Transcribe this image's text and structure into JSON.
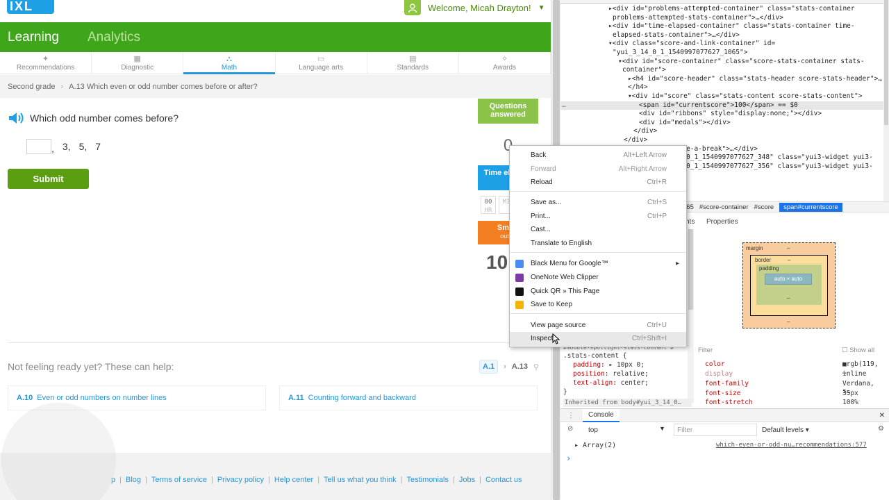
{
  "ixl": {
    "logo": "IXL",
    "welcome": "Welcome, Micah Drayton!",
    "nav": {
      "learning": "Learning",
      "analytics": "Analytics"
    },
    "subnav": [
      "Recommendations",
      "Diagnostic",
      "Math",
      "Language arts",
      "Standards",
      "Awards"
    ],
    "breadcrumb": {
      "grade": "Second grade",
      "sep": "›",
      "skill": "A.13 Which even or odd number comes before or after?"
    },
    "question": "Which odd number comes before?",
    "sequence": [
      ",",
      "3,",
      "5,",
      "7"
    ],
    "submit": "Submit",
    "stats": {
      "questions_answered_label": "Questions answered",
      "questions_answered_value": "0",
      "time_elapsed_label": "Time elapsed",
      "time_cells": [
        {
          "num": "00",
          "unit": "HR"
        },
        {
          "num": "",
          "unit": "MI"
        }
      ],
      "smartscore_label": "Smart",
      "smartscore_sub": "out of",
      "smartscore_value": "10"
    },
    "help": {
      "title": "Not feeling ready yet? These can help:",
      "path_from": "A.1",
      "path_arrow": "›",
      "path_to": "A.13",
      "cards": [
        {
          "code": "A.10",
          "label": "Even or odd numbers on number lines"
        },
        {
          "code": "A.11",
          "label": "Counting forward and backward"
        }
      ]
    },
    "footer_links": [
      "p",
      "Blog",
      "Terms of service",
      "Privacy policy",
      "Help center",
      "Tell us what you think",
      "Testimonials",
      "Jobs",
      "Contact us"
    ],
    "footer_sep": "|"
  },
  "devtools": {
    "elements": [
      {
        "text": "▸<div id=\"problems-attempted-container\" class=\"stats-container",
        "indent": 876
      },
      {
        "text": "problems-attempted-stats-container\">…</div>",
        "indent": 882
      },
      {
        "text": "▸<div id=\"time-elapsed-container\" class=\"stats-container time-",
        "indent": 876
      },
      {
        "text": "elapsed-stats-container\">…</div>",
        "indent": 882
      },
      {
        "text": "▾<div class=\"score-and-link-container\" id=",
        "indent": 876
      },
      {
        "text": "\"yui_3_14_0_1_1540997077627_1065\">",
        "indent": 882
      },
      {
        "text": "▾<div id=\"score-container\" class=\"score-stats-container stats-",
        "indent": 890
      },
      {
        "text": "container\">",
        "indent": 896
      },
      {
        "text": "▸<h4 id=\"score-header\" class=\"stats-header score-stats-header\">…",
        "indent": 904
      },
      {
        "text": "</h4>",
        "indent": 904
      },
      {
        "text": "▾<div id=\"score\" class=\"stats-content score-stats-content\">",
        "indent": 904
      },
      {
        "text": "<span id=\"currentscore\">100</span> == $0",
        "indent": 920,
        "selected": true
      },
      {
        "text": "<div id=\"ribbons\" style=\"display:none;\"></div>",
        "indent": 920
      },
      {
        "text": "<div id=\"medals\"></div>",
        "indent": 920
      },
      {
        "text": "</div>",
        "indent": 912
      },
      {
        "text": "</div>",
        "indent": 898
      },
      {
        "text": "e-a-break\">…</div>",
        "indent": 988
      },
      {
        "text": "0_1_1540997077627_348\" class=\"yui3-widget yui3-",
        "indent": 988
      },
      {
        "text": "0_1_1540997077627_356\" class=\"yui3-widget yui3-",
        "indent": 988
      }
    ],
    "selected_marker": "…",
    "crumbs": [
      "065",
      "#score-container",
      "#score",
      "span#currentscore"
    ],
    "styles_tabs": [
      "nts",
      "Properties"
    ],
    "box_model": {
      "margin": "margin",
      "margin_val": "–",
      "border": "border",
      "border_val": "–",
      "padding": "padding",
      "padding_val": "–",
      "content": "auto × auto"
    },
    "css_rule": {
      "selector_prev": "#module-spotlight-stats-content #",
      "selector": ".stats-content {",
      "props": [
        {
          "k": "padding:",
          "v": "▸ 10px 0;",
          "dim": false
        },
        {
          "k": "position:",
          "v": "relative;",
          "dim": false
        },
        {
          "k": "text-align:",
          "v": "center;",
          "dim": false
        }
      ],
      "close": "}",
      "inherited": "Inherited from body#yui_3_14_0…"
    },
    "filter": {
      "placeholder": "Filter",
      "show_all": "Show all"
    },
    "computed": [
      {
        "k": "color",
        "v": "■rgb(119, …",
        "dim": false
      },
      {
        "k": "display",
        "v": "inline",
        "dim": true
      },
      {
        "k": "font-family",
        "v": "Verdana, s…",
        "dim": false
      },
      {
        "k": "font-size",
        "v": "35px",
        "dim": false
      },
      {
        "k": "font-stretch",
        "v": "100%",
        "dim": false
      }
    ],
    "console": {
      "tab": "Console",
      "context": "top",
      "filter": "Filter",
      "levels": "Default levels ▾",
      "log": "▸ Array(2)",
      "source": "which-even-or-odd-nu…recommendations:577",
      "prompt": "›"
    }
  },
  "context_menu": {
    "items": [
      {
        "label": "Back",
        "shortcut": "Alt+Left Arrow",
        "disabled": false
      },
      {
        "label": "Forward",
        "shortcut": "Alt+Right Arrow",
        "disabled": true
      },
      {
        "label": "Reload",
        "shortcut": "Ctrl+R",
        "disabled": false
      },
      {
        "label": "Save as...",
        "shortcut": "Ctrl+S",
        "disabled": false
      },
      {
        "label": "Print...",
        "shortcut": "Ctrl+P",
        "disabled": false
      },
      {
        "label": "Cast...",
        "shortcut": "",
        "disabled": false
      },
      {
        "label": "Translate to English",
        "shortcut": "",
        "disabled": false
      },
      {
        "label": "Black Menu for Google™",
        "shortcut": "▸",
        "disabled": false,
        "icon": "#4a8cf0"
      },
      {
        "label": "OneNote Web Clipper",
        "shortcut": "",
        "disabled": false,
        "icon": "#7e3aa8"
      },
      {
        "label": "Quick QR » This Page",
        "shortcut": "",
        "disabled": false,
        "icon": "#111111"
      },
      {
        "label": "Save to Keep",
        "shortcut": "",
        "disabled": false,
        "icon": "#f5b400"
      },
      {
        "label": "View page source",
        "shortcut": "Ctrl+U",
        "disabled": false
      },
      {
        "label": "Inspect",
        "shortcut": "Ctrl+Shift+I",
        "disabled": false,
        "hover": true
      }
    ]
  },
  "colors": {
    "ixl_green": "#3fa51a",
    "ixl_blue": "#2596d7",
    "submit_green": "#5c9e12",
    "selection_blue": "#1a73e8"
  }
}
